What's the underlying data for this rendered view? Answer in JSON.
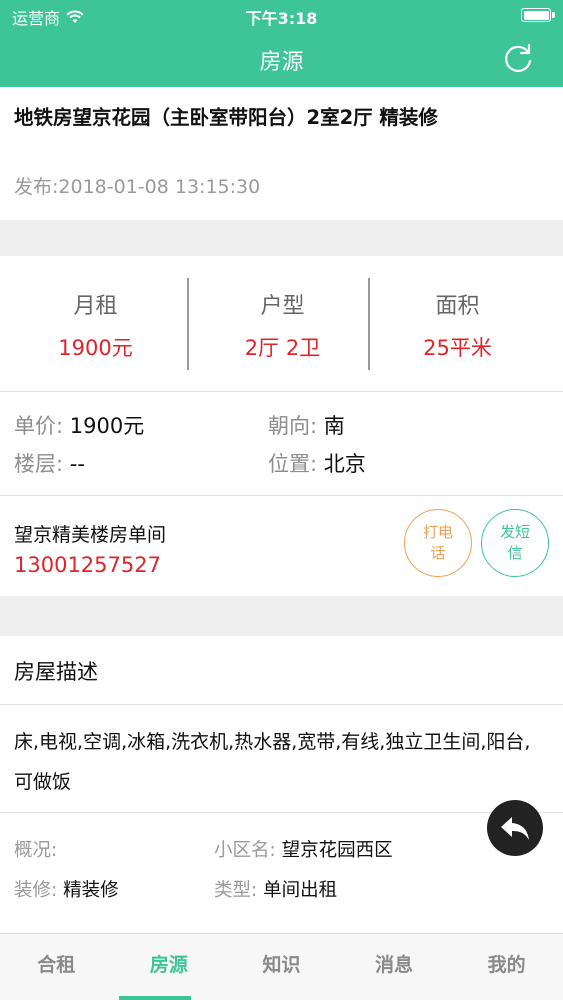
{
  "status_bar": {
    "carrier": "运营商",
    "time": "下午3:18"
  },
  "nav": {
    "title": "房源",
    "refresh_icon": "refresh-icon"
  },
  "listing": {
    "title": "地铁房望京花园（主卧室带阳台）2室2厅 精装修",
    "published": "发布:2018-01-08 13:15:30"
  },
  "stats": [
    {
      "label": "月租",
      "value": "1900元"
    },
    {
      "label": "户型",
      "value": "2厅 2卫"
    },
    {
      "label": "面积",
      "value": "25平米"
    }
  ],
  "details": {
    "unit_price": {
      "key": "单价:",
      "value": "1900元"
    },
    "orientation": {
      "key": "朝向:",
      "value": "南"
    },
    "floor": {
      "key": "楼层:",
      "value": "--"
    },
    "location": {
      "key": "位置:",
      "value": "北京"
    }
  },
  "contact": {
    "name": "望京精美楼房单间",
    "phone": "13001257527",
    "call_line1": "打电",
    "call_line2": "话",
    "sms_line1": "发短",
    "sms_line2": "信"
  },
  "description": {
    "heading": "房屋描述",
    "text": "床,电视,空调,冰箱,洗衣机,热水器,宽带,有线,独立卫生间,阳台,可做饭"
  },
  "meta": {
    "overview_key": "概况:",
    "overview_value": "",
    "community_key": "小区名:",
    "community_value": "望京花园西区",
    "decoration_key": "装修:",
    "decoration_value": "精装修",
    "type_key": "类型:",
    "type_value": "单间出租"
  },
  "tabs": [
    {
      "label": "合租"
    },
    {
      "label": "房源"
    },
    {
      "label": "知识"
    },
    {
      "label": "消息"
    },
    {
      "label": "我的"
    }
  ],
  "active_tab": "房源",
  "colors": {
    "accent": "#3ec597",
    "price": "#e0242a",
    "call": "#f0a05a"
  }
}
